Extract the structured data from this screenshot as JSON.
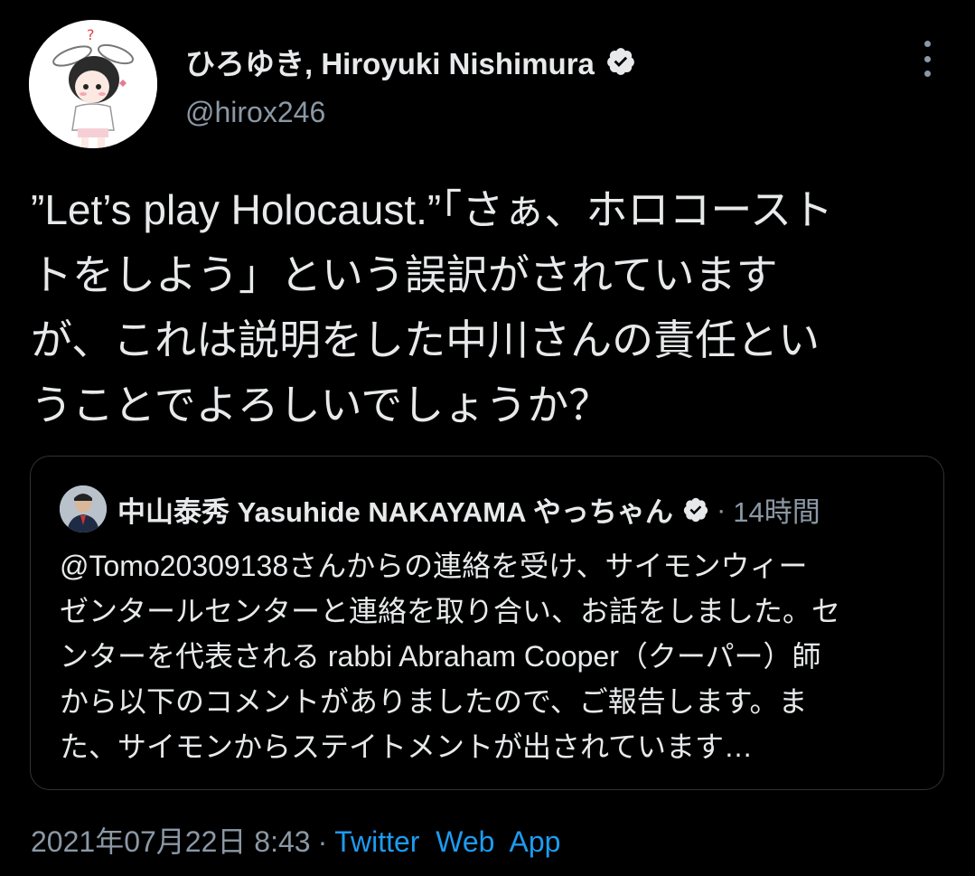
{
  "author": {
    "name": "ひろゆき, Hiroyuki Nishimura",
    "handle": "@hirox246"
  },
  "tweet": {
    "text": "”Let’s play Holocaust.”「さぁ、ホロコースト\nトをしよう」という誤訳がされています\nが、これは説明をした中川さんの責任とい\nうことでよろしいでしょうか？"
  },
  "quote": {
    "name": "中山泰秀 Yasuhide NAKAYAMA やっちゃん",
    "dot": "·",
    "time": "14時間",
    "text": "@Tomo20309138さんからの連絡を受け、サイモンウィー\nゼンタールセンターと連絡を取り合い、お話をしました。セ\nンターを代表される rabbi Abraham Cooper（クーパー）師\nから以下のコメントがありましたので、ご報告します。ま\nた、サイモンからステイトメントが出されています…"
  },
  "meta": {
    "datetime": "2021年07月22日 8:43",
    "sep": "·",
    "source": "Twitter  Web  App"
  },
  "colors": {
    "background": "#000000",
    "text": "#e7e9ea",
    "muted": "#8b98a5",
    "link": "#1d9bf0",
    "border": "#2f3336"
  },
  "icons": {
    "verified": "verified-badge-icon",
    "more": "more-vertical-icon"
  }
}
